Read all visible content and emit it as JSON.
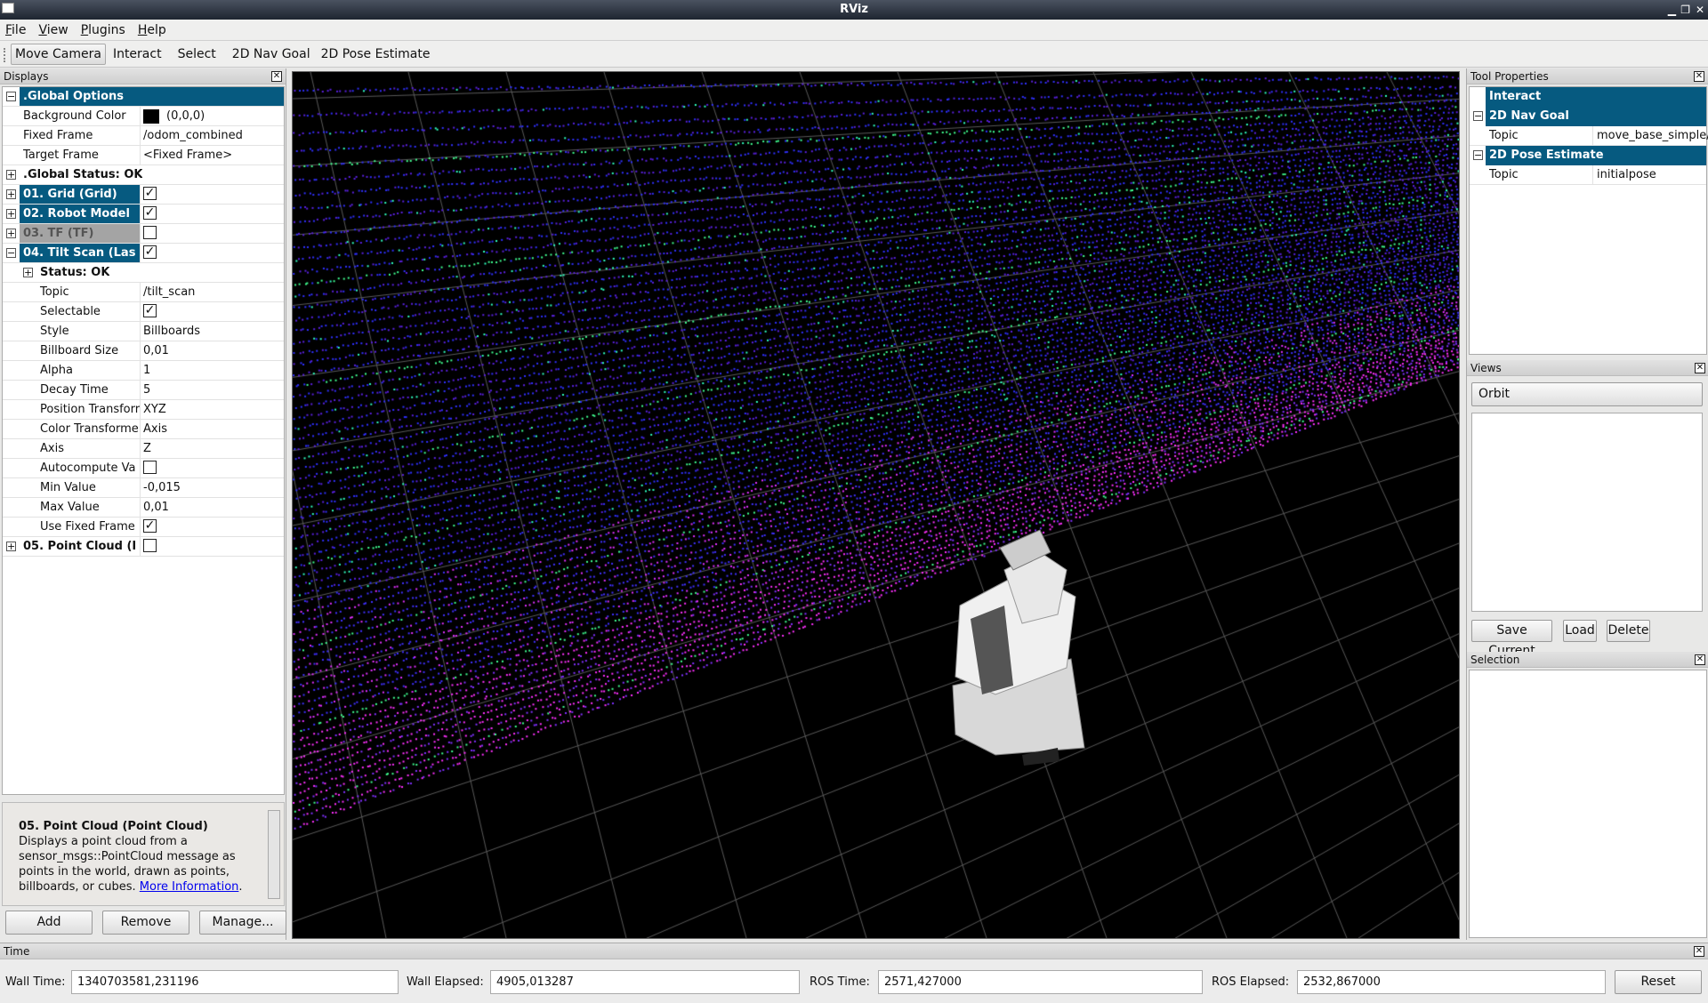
{
  "window": {
    "title": "RViz"
  },
  "menu": [
    "File",
    "View",
    "Plugins",
    "Help"
  ],
  "toolbar": {
    "tools": [
      "Move Camera",
      "Interact",
      "Select",
      "2D Nav Goal",
      "2D Pose Estimate"
    ],
    "active": "Move Camera"
  },
  "displays": {
    "title": "Displays",
    "global_options": {
      "label": ".Global Options",
      "background_color_label": "Background Color",
      "background_color_value": "(0,0,0)",
      "background_color": "#000000",
      "fixed_frame_label": "Fixed Frame",
      "fixed_frame": "/odom_combined",
      "target_frame_label": "Target Frame",
      "target_frame": "<Fixed Frame>"
    },
    "global_status": ".Global Status: OK",
    "items": [
      {
        "label": "01. Grid (Grid)",
        "checked": true
      },
      {
        "label": "02. Robot Model",
        "checked": true
      },
      {
        "label": "03. TF (TF)",
        "checked": false
      },
      {
        "label": "04. Tilt Scan (Las",
        "checked": true
      }
    ],
    "tilt_scan_status": "Status: OK",
    "tilt_scan_props": [
      {
        "label": "Topic",
        "value": "/tilt_scan"
      },
      {
        "label": "Selectable",
        "checkbox": true
      },
      {
        "label": "Style",
        "value": "Billboards"
      },
      {
        "label": "Billboard Size",
        "value": "0,01"
      },
      {
        "label": "Alpha",
        "value": "1"
      },
      {
        "label": "Decay Time",
        "value": "5"
      },
      {
        "label": "Position Transforr",
        "value": "XYZ"
      },
      {
        "label": "Color Transforme",
        "value": "Axis"
      },
      {
        "label": "Axis",
        "value": "Z"
      },
      {
        "label": "Autocompute Va",
        "checkbox": false
      },
      {
        "label": "Min Value",
        "value": "-0,015"
      },
      {
        "label": "Max Value",
        "value": "0,01"
      },
      {
        "label": "Use Fixed Frame",
        "checkbox": true
      }
    ],
    "point_cloud_item": {
      "label": "05. Point Cloud (I",
      "checked": false
    },
    "description": {
      "title": "05. Point Cloud (Point Cloud)",
      "text": "Displays a point cloud from a sensor_msgs::PointCloud message as points in the world, drawn as points, billboards, or cubes.",
      "link": "More Information",
      "after_link": "."
    },
    "buttons": {
      "add": "Add",
      "remove": "Remove",
      "manage": "Manage..."
    }
  },
  "tool_properties": {
    "title": "Tool Properties",
    "interact": "Interact",
    "nav_goal": {
      "label": "2D Nav Goal",
      "topic_label": "Topic",
      "topic": "move_base_simple/"
    },
    "pose_estimate": {
      "label": "2D Pose Estimate",
      "topic_label": "Topic",
      "topic": "initialpose"
    }
  },
  "views": {
    "title": "Views",
    "selected": "Orbit",
    "buttons": {
      "save": "Save Current",
      "load": "Load",
      "delete": "Delete"
    }
  },
  "selection": {
    "title": "Selection"
  },
  "time": {
    "title": "Time",
    "wall_time_label": "Wall Time:",
    "wall_time": "1340703581,231196",
    "wall_elapsed_label": "Wall Elapsed:",
    "wall_elapsed": "4905,013287",
    "ros_time_label": "ROS Time:",
    "ros_time": "2571,427000",
    "ros_elapsed_label": "ROS Elapsed:",
    "ros_elapsed": "2532,867000",
    "reset": "Reset"
  },
  "colors": {
    "header_blue": "#065a80",
    "disabled_grey": "#a4a4a4",
    "cloud_low": "#ff20ff",
    "cloud_high": "#2020ff",
    "cloud_mid": "#20ffb0"
  }
}
